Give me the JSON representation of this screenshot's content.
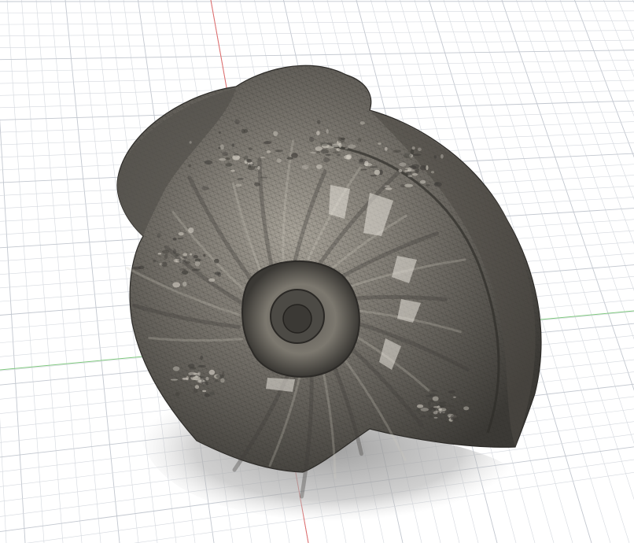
{
  "viewport": {
    "background": "#ffffff",
    "grid_line_color": "#d4d8de",
    "grid_major_color": "#c2c7cf",
    "axis_x_color": "#7fc87f",
    "axis_y_color": "#e06a6a",
    "model_color": "#6f6c66",
    "model_dark": "#3f3d39",
    "model_light": "#cfcac0",
    "shadow_color": "#9a9a9a"
  }
}
